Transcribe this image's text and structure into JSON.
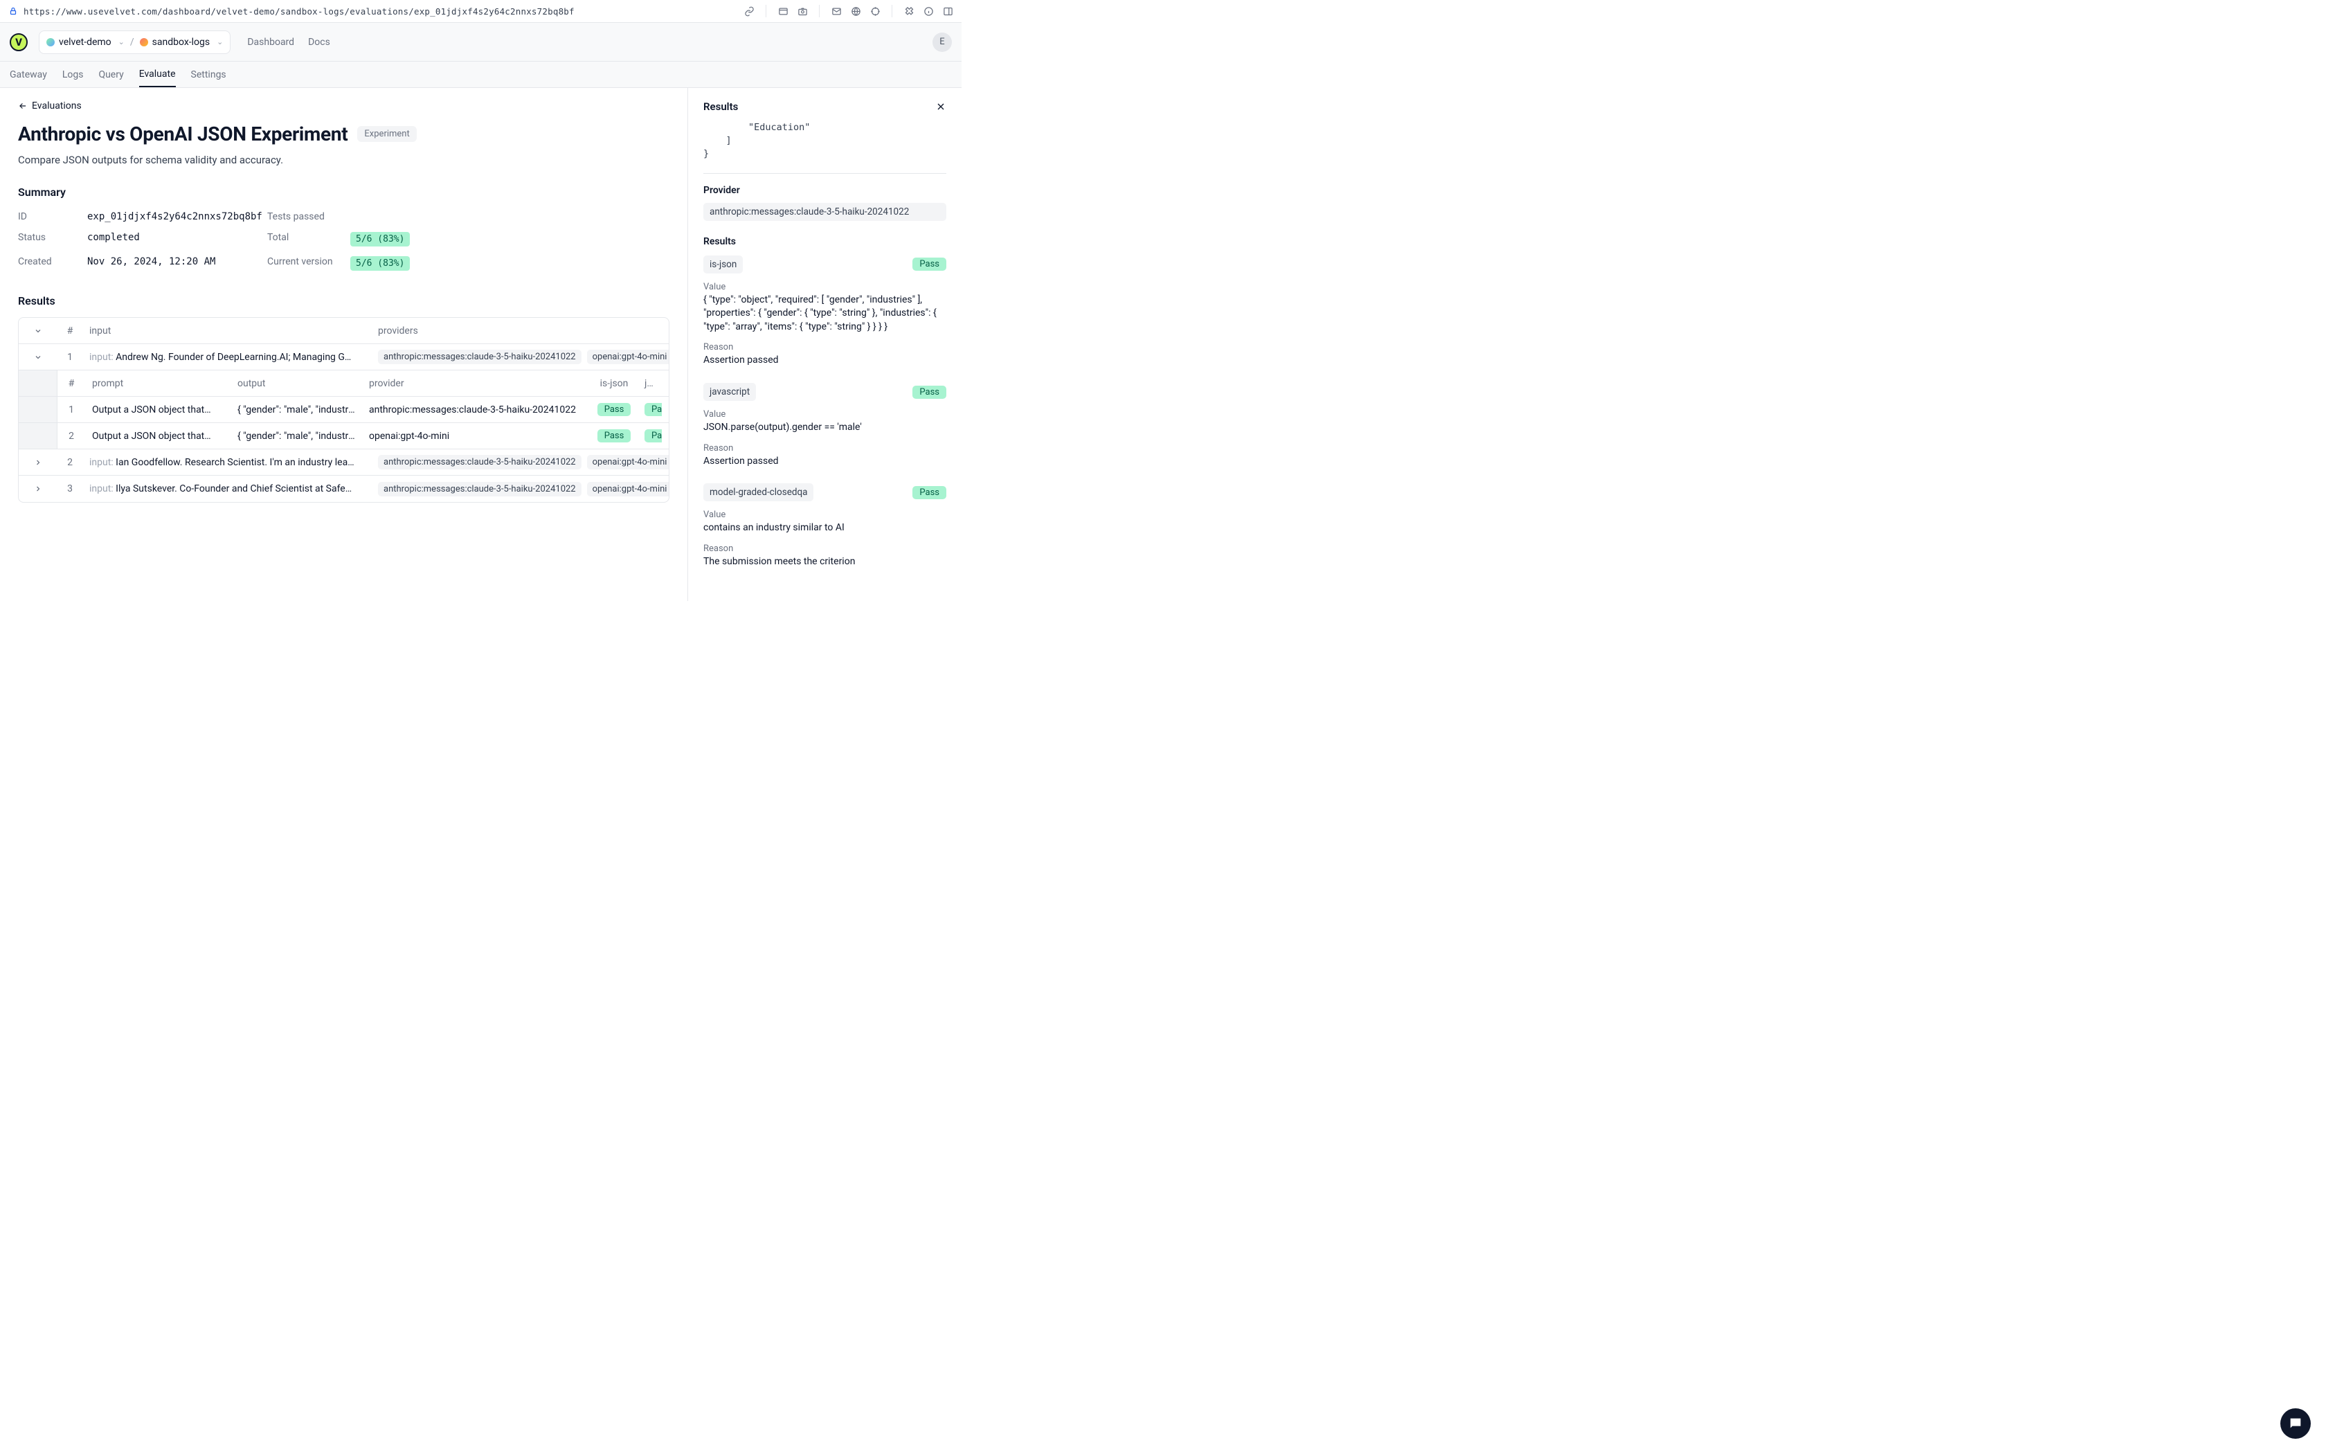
{
  "browser": {
    "url": "https://www.usevelvet.com/dashboard/velvet-demo/sandbox-logs/evaluations/exp_01jdjxf4s2y64c2nnxs72bq8bf"
  },
  "header": {
    "logo_letter": "V",
    "breadcrumb": {
      "org": "velvet-demo",
      "project": "sandbox-logs"
    },
    "nav": {
      "dashboard": "Dashboard",
      "docs": "Docs"
    },
    "avatar": "E"
  },
  "tabs": {
    "gateway": "Gateway",
    "logs": "Logs",
    "query": "Query",
    "evaluate": "Evaluate",
    "settings": "Settings"
  },
  "main": {
    "back": "Evaluations",
    "title": "Anthropic vs OpenAI JSON Experiment",
    "badge": "Experiment",
    "description": "Compare JSON outputs for schema validity and accuracy.",
    "summary_title": "Summary",
    "summary": {
      "id_label": "ID",
      "id_value": "exp_01jdjxf4s2y64c2nnxs72bq8bf",
      "status_label": "Status",
      "status_value": "completed",
      "created_label": "Created",
      "created_value": "Nov 26, 2024, 12:20 AM",
      "tests_label": "Tests passed",
      "total_label": "Total",
      "total_value": "5/6 (83%)",
      "version_label": "Current version",
      "version_value": "5/6 (83%)"
    },
    "results_title": "Results",
    "table": {
      "headers": {
        "num": "#",
        "input": "input",
        "providers": "providers"
      },
      "rows": [
        {
          "num": "1",
          "input": "Andrew Ng. Founder of DeepLearning.AI; Managing G…",
          "providers": [
            "anthropic:messages:claude-3-5-haiku-20241022",
            "openai:gpt-4o-mini"
          ],
          "expanded": true,
          "sub": {
            "headers": {
              "num": "#",
              "prompt": "prompt",
              "output": "output",
              "provider": "provider",
              "isjson": "is-json",
              "java": "java"
            },
            "rows": [
              {
                "num": "1",
                "prompt": "Output a JSON object that…",
                "output": "{ \"gender\": \"male\", \"industries…",
                "provider": "anthropic:messages:claude-3-5-haiku-20241022",
                "isjson": "Pass",
                "java": "Pa"
              },
              {
                "num": "2",
                "prompt": "Output a JSON object that…",
                "output": "{ \"gender\": \"male\", \"industries…",
                "provider": "openai:gpt-4o-mini",
                "isjson": "Pass",
                "java": "Pa"
              }
            ]
          }
        },
        {
          "num": "2",
          "input": "Ian Goodfellow. Research Scientist. I'm an industry lea…",
          "providers": [
            "anthropic:messages:claude-3-5-haiku-20241022",
            "openai:gpt-4o-mini"
          ],
          "expanded": false
        },
        {
          "num": "3",
          "input": "Ilya Sutskever. Co-Founder and Chief Scientist at Safe…",
          "providers": [
            "anthropic:messages:claude-3-5-haiku-20241022",
            "openai:gpt-4o-mini"
          ],
          "expanded": false
        }
      ]
    }
  },
  "panel": {
    "title": "Results",
    "snippet_line1": "        \"Education\"",
    "snippet_line2": "    ]",
    "snippet_line3": "}",
    "provider_label": "Provider",
    "provider_value": "anthropic:messages:claude-3-5-haiku-20241022",
    "results_label": "Results",
    "results": [
      {
        "name": "is-json",
        "status": "Pass",
        "value_label": "Value",
        "value": "{ \"type\": \"object\", \"required\": [ \"gender\", \"industries\" ], \"properties\": { \"gender\": { \"type\": \"string\" }, \"industries\": { \"type\": \"array\", \"items\": { \"type\": \"string\" } } } }",
        "reason_label": "Reason",
        "reason": "Assertion passed"
      },
      {
        "name": "javascript",
        "status": "Pass",
        "value_label": "Value",
        "value": "JSON.parse(output).gender == 'male'",
        "reason_label": "Reason",
        "reason": "Assertion passed"
      },
      {
        "name": "model-graded-closedqa",
        "status": "Pass",
        "value_label": "Value",
        "value": "contains an industry similar to AI",
        "reason_label": "Reason",
        "reason": "The submission meets the criterion"
      }
    ]
  }
}
